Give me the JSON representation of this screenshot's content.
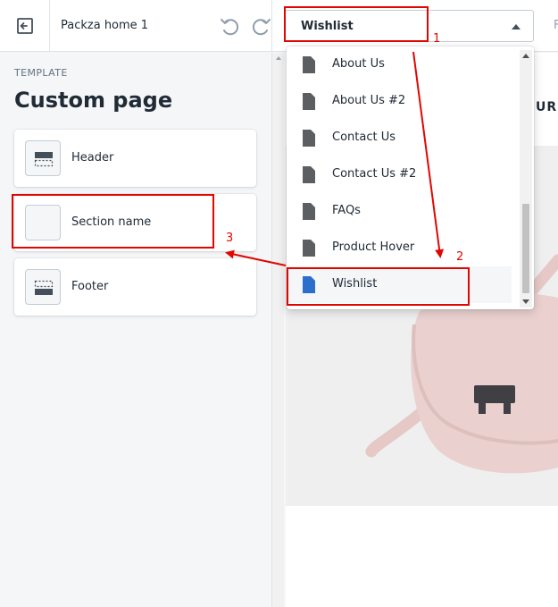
{
  "topbar": {
    "theme_name": "Packza home 1",
    "selected_page": "Wishlist",
    "right_fragment": "F"
  },
  "sidebar": {
    "template_label": "TEMPLATE",
    "title": "Custom page",
    "sections": [
      {
        "label": "Header",
        "icon": "header-layout-icon"
      },
      {
        "label": "Section name",
        "icon": "blank-section-icon"
      },
      {
        "label": "Footer",
        "icon": "footer-layout-icon"
      }
    ]
  },
  "dropdown": {
    "items": [
      {
        "label": "About Us",
        "icon": "page-icon",
        "selected": false
      },
      {
        "label": "About Us #2",
        "icon": "page-icon",
        "selected": false
      },
      {
        "label": "Contact Us",
        "icon": "page-icon",
        "selected": false
      },
      {
        "label": "Contact Us #2",
        "icon": "page-icon",
        "selected": false
      },
      {
        "label": "FAQs",
        "icon": "page-icon",
        "selected": false
      },
      {
        "label": "Product Hover",
        "icon": "page-icon",
        "selected": false
      },
      {
        "label": "Wishlist",
        "icon": "page-icon",
        "selected": true
      }
    ]
  },
  "preview": {
    "heading_fragment": "URE"
  },
  "annotations": {
    "step_1": "1",
    "step_2": "2",
    "step_3": "3",
    "color": "#e10600"
  },
  "colors": {
    "accent": "#2c6ecb",
    "icon_gray": "#5c5f62",
    "annotation": "#e10600"
  }
}
